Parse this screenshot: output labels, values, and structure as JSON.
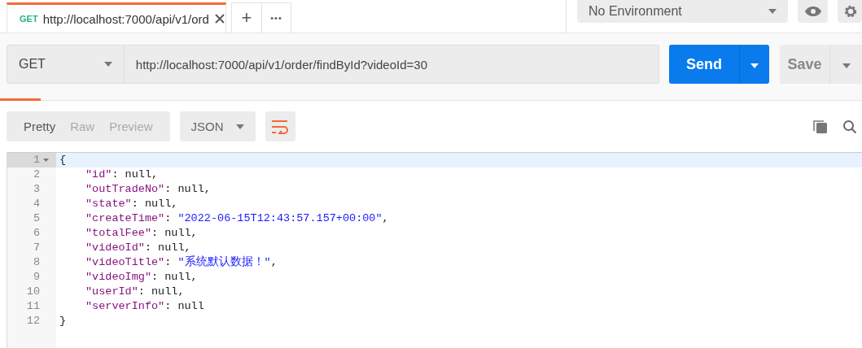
{
  "tabs": [
    {
      "method": "GET",
      "title": "http://localhost:7000/api/v1/ord",
      "selected": true
    }
  ],
  "tab_actions": {
    "add": "+",
    "more": "•••"
  },
  "environment": {
    "value": "No Environment"
  },
  "request": {
    "method": "GET",
    "url": "http://localhost:7000/api/v1/order/findById?videoId=30",
    "send": "Send",
    "save": "Save"
  },
  "response": {
    "views": [
      {
        "label": "Pretty",
        "selected": true
      },
      {
        "label": "Raw",
        "selected": false
      },
      {
        "label": "Preview",
        "selected": false
      }
    ],
    "format": "JSON",
    "lines": [
      {
        "number": "1",
        "kind": "brace",
        "fold": true,
        "current": true,
        "tokens": [
          {
            "text": "{",
            "kind": "plain"
          }
        ]
      },
      {
        "number": "2",
        "kind": "pair",
        "fold": false,
        "current": false,
        "tokens": [
          {
            "text": "\"id\"",
            "kind": "key"
          },
          {
            "text": ": null,",
            "kind": "plain"
          }
        ]
      },
      {
        "number": "3",
        "kind": "pair",
        "fold": false,
        "current": false,
        "tokens": [
          {
            "text": "\"outTradeNo\"",
            "kind": "key"
          },
          {
            "text": ": null,",
            "kind": "plain"
          }
        ]
      },
      {
        "number": "4",
        "kind": "pair",
        "fold": false,
        "current": false,
        "tokens": [
          {
            "text": "\"state\"",
            "kind": "key"
          },
          {
            "text": ": null,",
            "kind": "plain"
          }
        ]
      },
      {
        "number": "5",
        "kind": "pair",
        "fold": false,
        "current": false,
        "tokens": [
          {
            "text": "\"createTime\"",
            "kind": "key"
          },
          {
            "text": ": ",
            "kind": "plain"
          },
          {
            "text": "\"2022-06-15T12:43:57.157+00:00\"",
            "kind": "string"
          },
          {
            "text": ",",
            "kind": "plain"
          }
        ]
      },
      {
        "number": "6",
        "kind": "pair",
        "fold": false,
        "current": false,
        "tokens": [
          {
            "text": "\"totalFee\"",
            "kind": "key"
          },
          {
            "text": ": null,",
            "kind": "plain"
          }
        ]
      },
      {
        "number": "7",
        "kind": "pair",
        "fold": false,
        "current": false,
        "tokens": [
          {
            "text": "\"videoId\"",
            "kind": "key"
          },
          {
            "text": ": null,",
            "kind": "plain"
          }
        ]
      },
      {
        "number": "8",
        "kind": "pair",
        "fold": false,
        "current": false,
        "tokens": [
          {
            "text": "\"videoTitle\"",
            "kind": "key"
          },
          {
            "text": ": ",
            "kind": "plain"
          },
          {
            "text": "\"系统默认数据！\"",
            "kind": "string"
          },
          {
            "text": ",",
            "kind": "plain"
          }
        ]
      },
      {
        "number": "9",
        "kind": "pair",
        "fold": false,
        "current": false,
        "tokens": [
          {
            "text": "\"videoImg\"",
            "kind": "key"
          },
          {
            "text": ": null,",
            "kind": "plain"
          }
        ]
      },
      {
        "number": "10",
        "kind": "pair",
        "fold": false,
        "current": false,
        "tokens": [
          {
            "text": "\"userId\"",
            "kind": "key"
          },
          {
            "text": ": null,",
            "kind": "plain"
          }
        ]
      },
      {
        "number": "11",
        "kind": "pair",
        "fold": false,
        "current": false,
        "tokens": [
          {
            "text": "\"serverInfo\"",
            "kind": "key"
          },
          {
            "text": ": null",
            "kind": "plain"
          }
        ]
      },
      {
        "number": "12",
        "kind": "brace",
        "fold": false,
        "current": false,
        "tokens": [
          {
            "text": "}",
            "kind": "plain"
          }
        ]
      }
    ]
  }
}
